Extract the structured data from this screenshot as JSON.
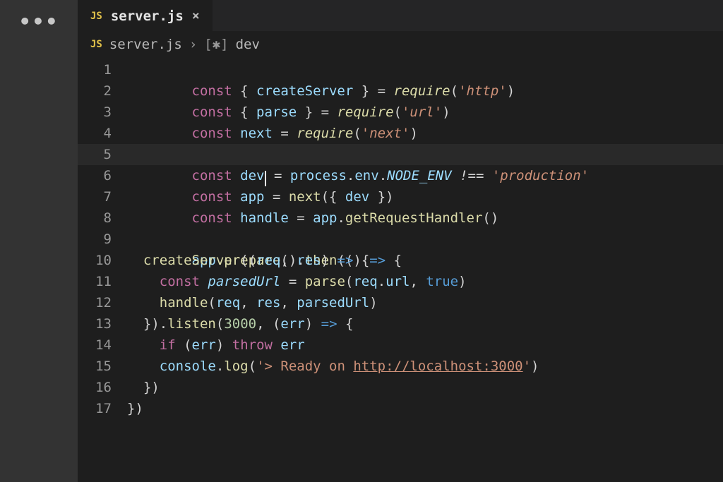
{
  "activity": {
    "ellipsis": "•••"
  },
  "tab": {
    "icon": "JS",
    "label": "server.js",
    "close": "×"
  },
  "breadcrumb": {
    "icon": "JS",
    "file": "server.js",
    "sep": "›",
    "sym_icon": "[✱]",
    "symbol": "dev"
  },
  "code": {
    "l1": {
      "a": "const",
      "b": " { ",
      "c": "createServer",
      "d": " } = ",
      "e": "require",
      "f": "(",
      "g": "'http'",
      "h": ")"
    },
    "l2": {
      "a": "const",
      "b": " { ",
      "c": "parse",
      "d": " } = ",
      "e": "require",
      "f": "(",
      "g": "'url'",
      "h": ")"
    },
    "l3": {
      "a": "const",
      "b": " ",
      "c": "next",
      "d": " = ",
      "e": "require",
      "f": "(",
      "g": "'next'",
      "h": ")"
    },
    "l5": {
      "a": "const",
      "b": " ",
      "c": "dev",
      "d": " = ",
      "e": "process",
      "f": ".",
      "g": "env",
      "h": ".",
      "i": "NODE_ENV",
      "j": " !== ",
      "k": "'production'"
    },
    "l6": {
      "a": "const",
      "b": " ",
      "c": "app",
      "d": " = ",
      "e": "next",
      "f": "({ ",
      "g": "dev",
      "h": " })"
    },
    "l7": {
      "a": "const",
      "b": " ",
      "c": "handle",
      "d": " = ",
      "e": "app",
      "f": ".",
      "g": "getRequestHandler",
      "h": "()"
    },
    "l9": {
      "a": "app",
      "b": ".",
      "c": "prepare",
      "d": "().",
      "e": "then",
      "f": "(() ",
      "g": "=>",
      "h": " {"
    },
    "l10": {
      "ind": "  ",
      "a": "createServer",
      "b": "((",
      "c": "req",
      "d": ", ",
      "e": "res",
      "f": ") ",
      "g": "=>",
      "h": " {"
    },
    "l11": {
      "ind": "    ",
      "a": "const",
      "b": " ",
      "c": "parsedUrl",
      "d": " = ",
      "e": "parse",
      "f": "(",
      "g": "req",
      "h": ".",
      "i": "url",
      "j": ", ",
      "k": "true",
      "l": ")"
    },
    "l12": {
      "ind": "    ",
      "a": "handle",
      "b": "(",
      "c": "req",
      "d": ", ",
      "e": "res",
      "f": ", ",
      "g": "parsedUrl",
      "h": ")"
    },
    "l13": {
      "ind": "  ",
      "a": "}).",
      "b": "listen",
      "c": "(",
      "d": "3000",
      "e": ", (",
      "f": "err",
      "g": ") ",
      "h": "=>",
      "i": " {"
    },
    "l14": {
      "ind": "    ",
      "a": "if",
      "b": " (",
      "c": "err",
      "d": ") ",
      "e": "throw",
      "f": " ",
      "g": "err"
    },
    "l15": {
      "ind": "    ",
      "a": "console",
      "b": ".",
      "c": "log",
      "d": "(",
      "e": "'> Ready on ",
      "f": "http://localhost:3000",
      "g": "'",
      "h": ")"
    },
    "l16": {
      "ind": "  ",
      "a": "})"
    },
    "l17": {
      "a": "})"
    }
  },
  "line_numbers": [
    "1",
    "2",
    "3",
    "4",
    "5",
    "6",
    "7",
    "8",
    "9",
    "10",
    "11",
    "12",
    "13",
    "14",
    "15",
    "16",
    "17"
  ]
}
